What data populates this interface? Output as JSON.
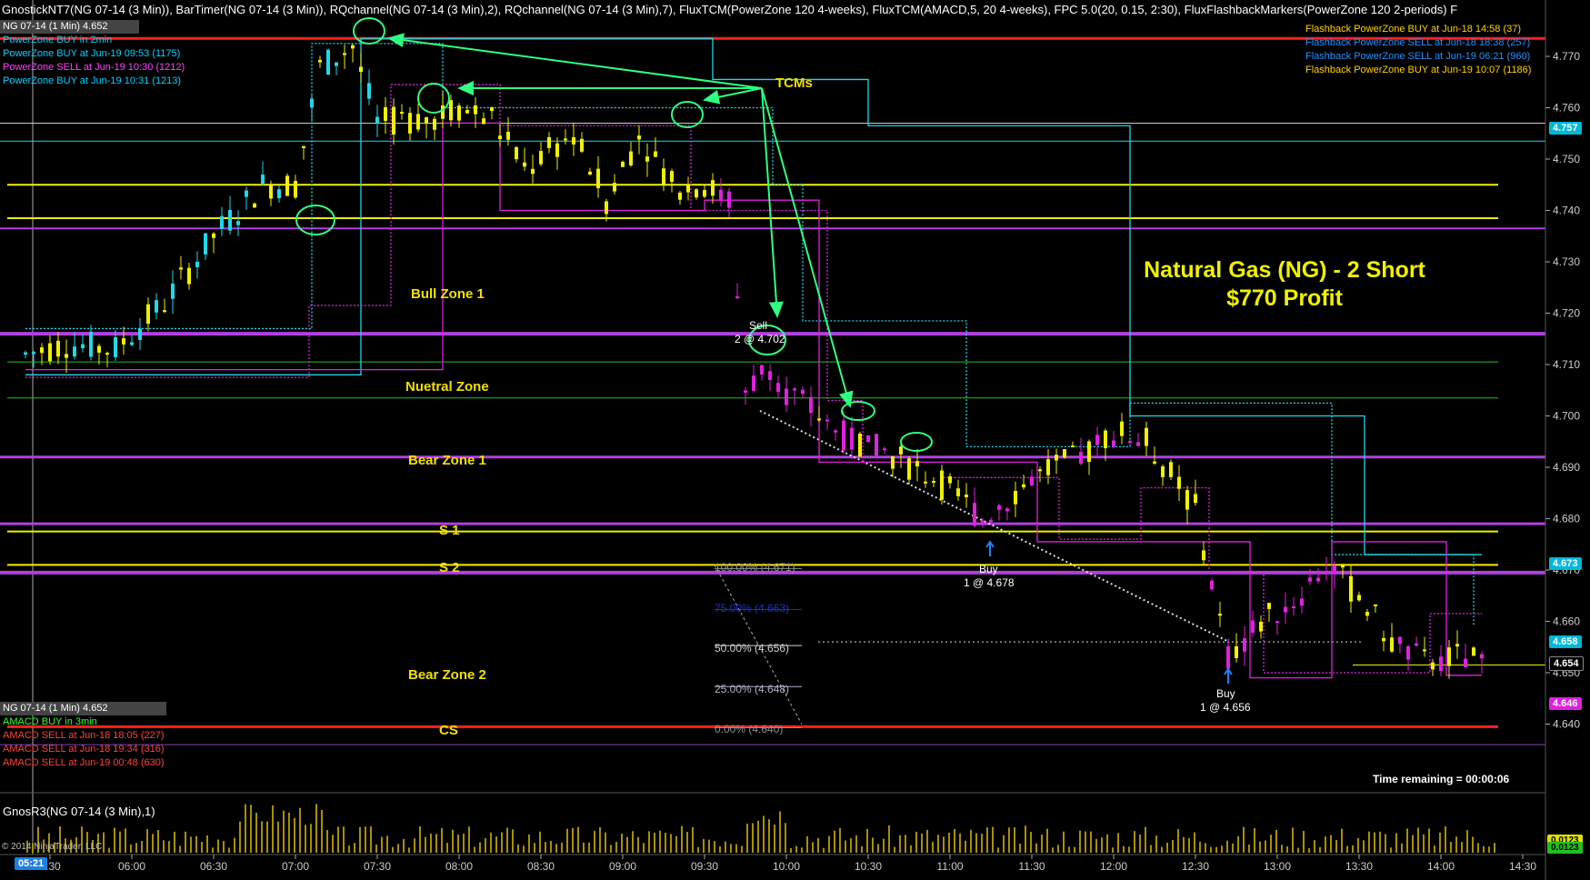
{
  "header": {
    "title": "GnostickNT7(NG 07-14 (3 Min)), BarTimer(NG 07-14 (3 Min)), RQchannel(NG 07-14 (3 Min),2), RQchannel(NG 07-14 (3 Min),7), FluxTCM(PowerZone 120 4-weeks), FluxTCM(AMACD,5, 20 4-weeks), FPC 5.0(20, 0.15, 2:30), FluxFlashbackMarkers(PowerZone 120 2-periods) F"
  },
  "info_top_left": {
    "instrument": "NG 07-14 (1 Min) 4.652",
    "lines": [
      {
        "text": "PowerZone BUY in 2min",
        "color": "#00d0ff"
      },
      {
        "text": "PowerZone BUY at Jun-19 09:53 (1175)",
        "color": "#00d0ff"
      },
      {
        "text": "PowerZone SELL at Jun-19 10:30 (1212)",
        "color": "#ff40ff"
      },
      {
        "text": "PowerZone BUY at Jun-19 10:31 (1213)",
        "color": "#00d0ff"
      }
    ]
  },
  "info_top_right": {
    "lines": [
      {
        "text": "Flashback PowerZone BUY at Jun-18 14:58 (37)",
        "color": "#ffd000"
      },
      {
        "text": "Flashback PowerZone SELL at Jun-18 18:38 (257)",
        "color": "#2090ff"
      },
      {
        "text": "Flashback PowerZone SELL at Jun-19 06:21 (960)",
        "color": "#2090ff"
      },
      {
        "text": "Flashback PowerZone BUY at Jun-19 10:07 (1186)",
        "color": "#ffd000"
      }
    ]
  },
  "info_bottom_left": {
    "instrument": "NG 07-14 (1 Min) 4.652",
    "lines": [
      {
        "text": "AMACD BUY in 3min",
        "color": "#30ff30"
      },
      {
        "text": "AMACD SELL at Jun-18 18:05 (227)",
        "color": "#ff4040"
      },
      {
        "text": "AMACD SELL at Jun-18 19:34 (316)",
        "color": "#ff4040"
      },
      {
        "text": "AMACD SELL at Jun-19 00:48 (630)",
        "color": "#ff4040"
      }
    ]
  },
  "annotations": {
    "tcms": "TCMs",
    "headline_1": "Natural Gas (NG) - 2 Short",
    "headline_2": "$770 Profit",
    "zones": {
      "bull_zone_1": "Bull Zone 1",
      "neutral_zone": "Nuetral Zone",
      "bear_zone_1": "Bear Zone 1",
      "s1": "S 1",
      "s2": "S 2",
      "bear_zone_2": "Bear Zone 2",
      "cs": "CS"
    },
    "sell_label_1": "Sell",
    "sell_label_2": "2 @ 4.702",
    "buy1_label_1": "Buy",
    "buy1_label_2": "1 @ 4.678",
    "buy2_label_1": "Buy",
    "buy2_label_2": "1 @ 4.656",
    "time_remaining": "Time remaining = 00:00:06"
  },
  "fib_levels": [
    {
      "text": "100.00% (4.671)",
      "color": "#909090"
    },
    {
      "text": "75.00% (4.663)",
      "color": "#2030c0"
    },
    {
      "text": "50.00% (4.656)",
      "color": "#d0d0d0"
    },
    {
      "text": "25.00% (4.648)",
      "color": "#b0b0c8"
    },
    {
      "text": "0.00% (4.640)",
      "color": "#909090"
    }
  ],
  "price_axis": {
    "ticks": [
      "4.770",
      "4.760",
      "4.750",
      "4.740",
      "4.730",
      "4.720",
      "4.710",
      "4.700",
      "4.690",
      "4.680",
      "4.670",
      "4.660",
      "4.650",
      "4.640"
    ],
    "badges": [
      {
        "text": "4.757",
        "color": "#00b8d8"
      },
      {
        "text": "4.673",
        "color": "#00b8d8"
      },
      {
        "text": "4.658",
        "color": "#00b8d8"
      },
      {
        "text": "4.654",
        "color": "#000000"
      },
      {
        "text": "4.646",
        "color": "#e020e0"
      }
    ]
  },
  "time_axis": {
    "cursor_time": "05:21",
    "ticks": [
      "5:30",
      "06:00",
      "06:30",
      "07:00",
      "07:30",
      "08:00",
      "08:30",
      "09:00",
      "09:30",
      "10:00",
      "10:30",
      "11:00",
      "11:30",
      "12:00",
      "12:30",
      "13:00",
      "13:30",
      "14:00",
      "14:30"
    ]
  },
  "lower_panel": {
    "label": "GnosR3(NG 07-14 (3 Min),1)",
    "badge_1": "0.0123",
    "badge_2": "0.0123"
  },
  "copyright": "© 2014 NinjaTrader, LLC",
  "colors": {
    "yellow": "#f0f000",
    "magenta": "#e020e0",
    "cyan": "#20d8e8",
    "green_annot": "#30ff80",
    "red_line": "#ff2020",
    "purple_line": "#b040e0"
  }
}
